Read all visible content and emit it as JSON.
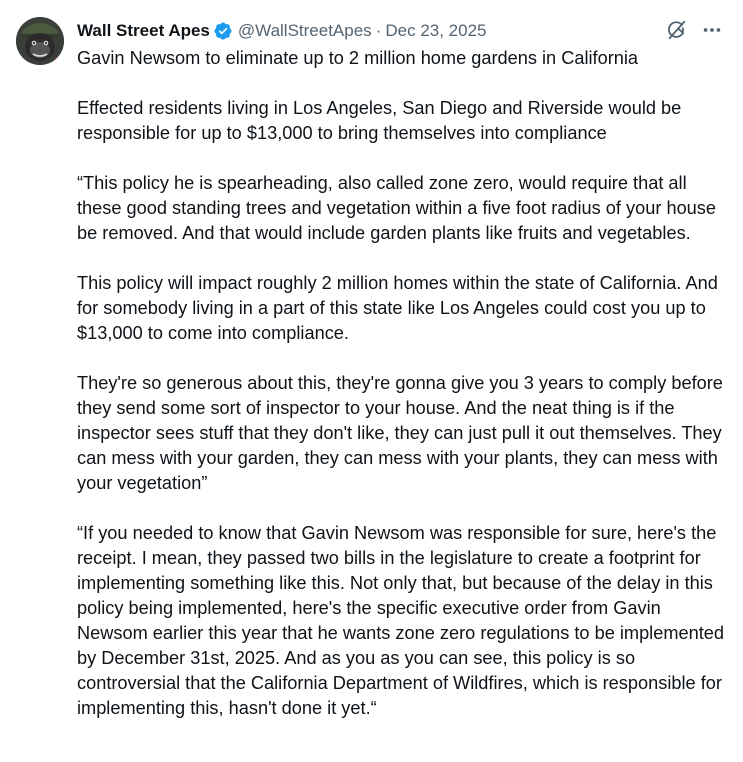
{
  "author": {
    "display_name": "Wall Street Apes",
    "handle": "@WallStreetApes",
    "separator": "·",
    "date": "Dec 23, 2025",
    "avatar_icon": "gorilla-avatar-icon",
    "verified_icon": "verified-badge-icon",
    "verified_color": "#1d9bf0"
  },
  "actions": {
    "grok_icon": "grok-icon",
    "more_icon": "more-options-icon"
  },
  "tweet": {
    "paragraphs": [
      "Gavin Newsom to eliminate up to 2 million home gardens in California",
      "Effected residents living in Los Angeles, San Diego and Riverside would be responsible for up to $13,000 to bring themselves into compliance",
      "“This policy he is spearheading, also called zone zero, would require that all these good standing trees and vegetation within a five foot radius of your house be removed. And that would include garden plants like fruits and vegetables.",
      "This policy will impact roughly 2 million homes within the state of California. And for somebody living in a part of this state like Los Angeles could cost you up to $13,000 to come into compliance.",
      "They're so generous about this, they're gonna give you 3 years to comply before they send some sort of inspector to your house. And the neat thing is if the inspector sees stuff that they don't like, they can just pull it out themselves. They can mess with your garden, they can mess with your plants, they can mess with your vegetation”",
      "“If you needed to know that Gavin Newsom was responsible for sure, here's the receipt. I mean, they passed two bills in the legislature to create a footprint for implementing something like this. Not only that, but because of the delay in this policy being implemented, here's the specific executive order from Gavin Newsom earlier this year that he wants zone zero regulations to be implemented by December 31st, 2025. And as you as you can see, this policy is so controversial that the California Department of Wildfires, which is responsible for implementing this, hasn't done it yet.“"
    ]
  }
}
